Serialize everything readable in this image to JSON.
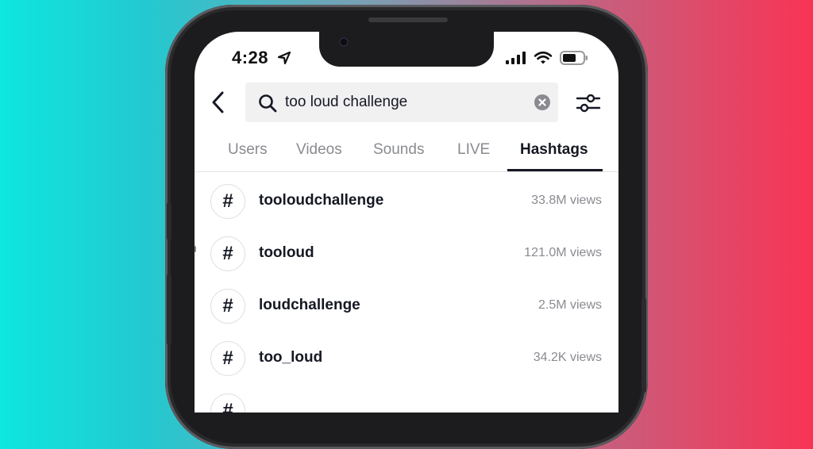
{
  "status_bar": {
    "time": "4:28"
  },
  "search": {
    "query": "too loud challenge"
  },
  "tabs": [
    {
      "label": "Users",
      "active": false
    },
    {
      "label": "Videos",
      "active": false
    },
    {
      "label": "Sounds",
      "active": false
    },
    {
      "label": "LIVE",
      "active": false
    },
    {
      "label": "Hashtags",
      "active": true
    }
  ],
  "results": [
    {
      "name": "tooloudchallenge",
      "views": "33.8M views"
    },
    {
      "name": "tooloud",
      "views": "121.0M views"
    },
    {
      "name": "loudchallenge",
      "views": "2.5M views"
    },
    {
      "name": "too_loud",
      "views": "34.2K views"
    },
    {
      "name": "",
      "views": ""
    }
  ],
  "hash_symbol": "#",
  "colors": {
    "text_primary": "#161823",
    "text_secondary": "#8a8b91",
    "search_bg": "#f1f1f2",
    "gradient_left": "#0ee6e0",
    "gradient_right": "#f83455"
  },
  "icons": [
    "back-arrow-icon",
    "search-icon",
    "clear-icon",
    "filter-sliders-icon",
    "location-arrow-icon",
    "signal-icon",
    "wifi-icon",
    "battery-icon",
    "hashtag-icon"
  ]
}
